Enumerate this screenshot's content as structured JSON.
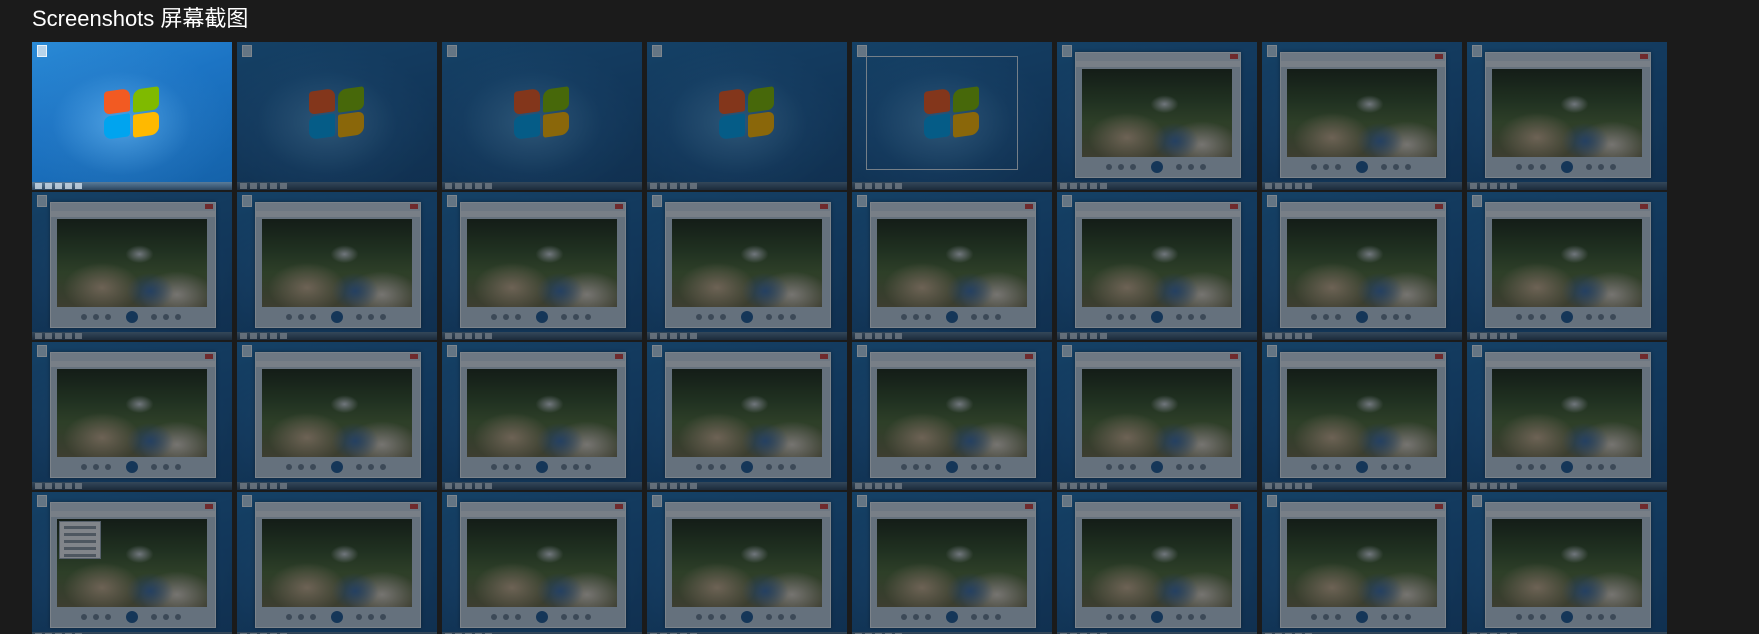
{
  "header": {
    "section_title": "Screenshots  屏幕截图"
  },
  "gallery": {
    "columns": 8,
    "rows": 4,
    "active_index": 0,
    "thumbnails": [
      {
        "kind": "desktop-bright"
      },
      {
        "kind": "desktop-fade"
      },
      {
        "kind": "desktop-fade"
      },
      {
        "kind": "desktop-fade"
      },
      {
        "kind": "desktop-window-outline"
      },
      {
        "kind": "player"
      },
      {
        "kind": "player"
      },
      {
        "kind": "player"
      },
      {
        "kind": "player"
      },
      {
        "kind": "player"
      },
      {
        "kind": "player"
      },
      {
        "kind": "player"
      },
      {
        "kind": "player"
      },
      {
        "kind": "player"
      },
      {
        "kind": "player"
      },
      {
        "kind": "player"
      },
      {
        "kind": "player"
      },
      {
        "kind": "player"
      },
      {
        "kind": "player"
      },
      {
        "kind": "player"
      },
      {
        "kind": "player"
      },
      {
        "kind": "player"
      },
      {
        "kind": "player"
      },
      {
        "kind": "player"
      },
      {
        "kind": "player-menu"
      },
      {
        "kind": "player"
      },
      {
        "kind": "player"
      },
      {
        "kind": "player"
      },
      {
        "kind": "player"
      },
      {
        "kind": "player"
      },
      {
        "kind": "player"
      },
      {
        "kind": "player"
      }
    ]
  }
}
